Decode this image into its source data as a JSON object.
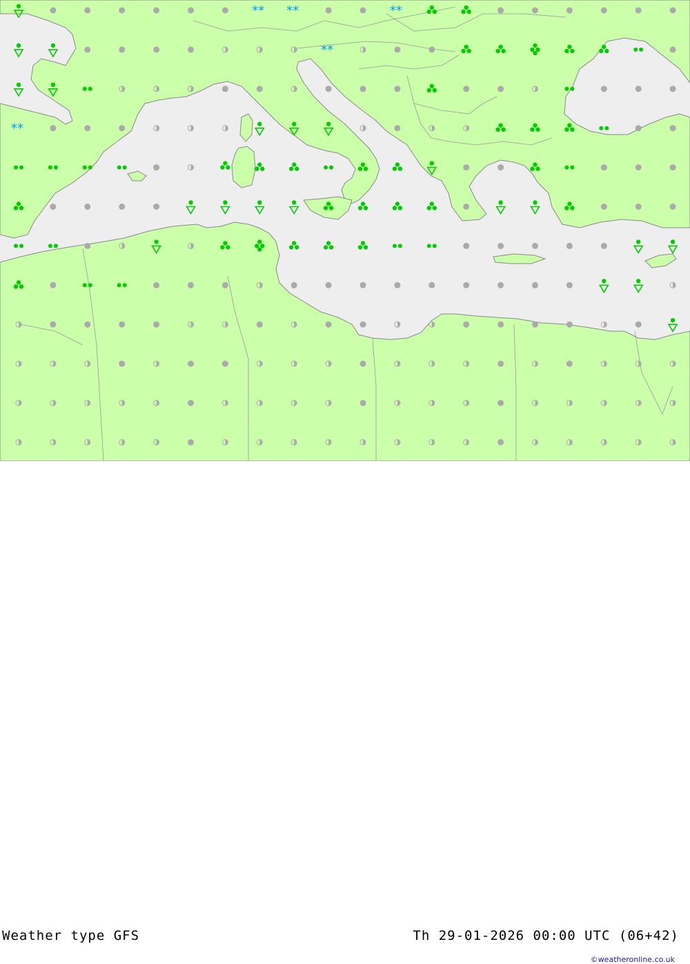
{
  "footer": {
    "title": "Weather type  GFS",
    "datetime": "Th 29-01-2026 00:00 UTC (06+42)",
    "credit": "©weatheronline.co.uk"
  },
  "colors": {
    "land": "#ccffaa",
    "sea": "#eeeeee",
    "border": "#999999",
    "coast": "#808080",
    "precip": "#00cc00",
    "snow": "#0099ff",
    "cloud": "#aaaaaa"
  },
  "symbol_legend": {
    "o": "clear",
    "h": "partly-cloudy",
    "c": "cloudy",
    "d": "drizzle",
    "r": "rain",
    "R": "heavy-rain",
    "S": "rain-shower",
    "T": "rain-shower-heavy",
    "*": "snow",
    "Z": "snow-shower"
  },
  "grid": {
    "columns": 20,
    "rows": 12,
    "cells": [
      "TccccccccsccsrrcccccccccTTccChs*csrrrrrcccccccccc",
      "TTcccchhcccshrrccsrrcccc",
      "dd"
    ]
  },
  "symbols": [
    "Tcchcccc*c*rrhhcchhcccc",
    "TTccchh**h*rRrRrdhcccccc"
  ]
}
